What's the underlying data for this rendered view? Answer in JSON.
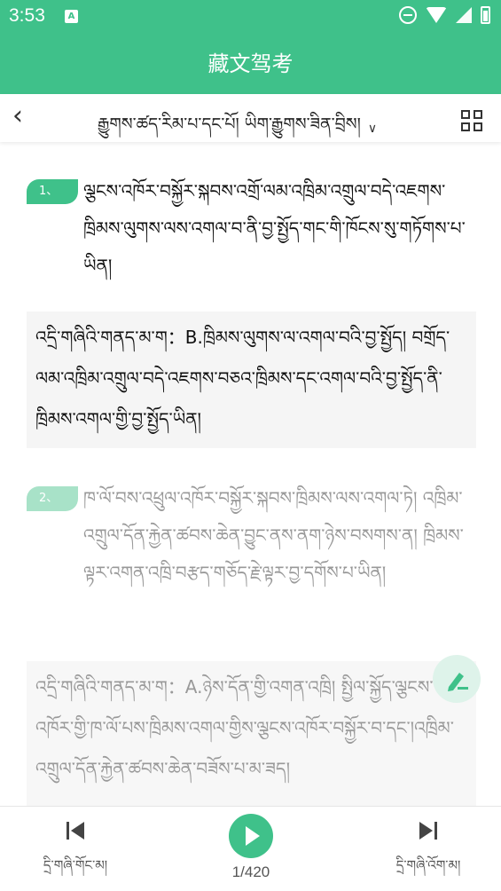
{
  "status_bar": {
    "time": "3:53",
    "sim_label": "A"
  },
  "app": {
    "title": "藏文驾考"
  },
  "nav": {
    "chapter_label": "རྒྱུགས་ཚད་རིམ་པ་དང་པོ། ཡིག་རྒྱུགས་ཟིན་བྲིས།"
  },
  "questions": [
    {
      "number": "1、",
      "text": "ལྕངས་འཁོར་བསྐྱོར་སྐབས་འགྲོ་ལམ་འཁྲིམ་འགྲུལ་བདེ་འཇགས་ཁྲིམས་ལུགས་ལས་འགལ་བ་ནི་བྱ་སྤྱོད་གང་གི་ཁོངས་སུ་གཏོགས་པ་ཡིན།",
      "answer": "འདྲི་གཞིའི་གནད་མ་ག：B.ཁྲིམས་ལུགས་ལ་འགལ་བའི་བྱ་སྤྱོད། བགྲོད་ལམ་འཁྲིམ་འགྲུལ་བདེ་འཇགས་བཅའ་ཁྲིམས་དང་འགལ་བའི་བྱ་སྤྱོད་ནི་ཁྲིམས་འགལ་གྱི་བྱ་སྤྱོད་ཡིན།"
    },
    {
      "number": "2、",
      "text": "ཁ་ལོ་བས་འཕྲུལ་འཁོར་བསྐྱོར་སྐབས་ཁྲིམས་ལས་འགལ་ཏེ། འཁྲིམ་འགྲུལ་དོན་རྐྱེན་ཚབས་ཆེན་བྱུང་ནས་ནག་ཉེས་བསགས་ན། ཁྲིམས་ལྟར་འགན་འཁྲི་བརྩད་གཅོད་རྗེ་ལྟར་བྱ་དགོས་པ་ཡིན།",
      "answer": "འདྲི་གཞིའི་གནད་མ་ག：A.ཉེས་དོན་གྱི་འགན་འཁྲི། སྤྱིལ་སྐྱོད་ལྕངས་འཁོར་གྱི་ཁ་ལོ་པས་ཁྲིམས་འགལ་གྱིས་ལྕངས་འཁོར་བསྐྱོར་བ་དང་།འཁྲིམ་འགྲུལ་དོན་རྐྱེན་ཚབས་ཆེན་བཟོས་པ་མ་ཟད།"
    }
  ],
  "bottom": {
    "prev_label": "དྲི་གཞི་གོང་མ།",
    "next_label": "དྲི་གཞི་འོག་མ།",
    "counter": "1/420"
  },
  "colors": {
    "accent": "#3fc18a",
    "accent_light": "#a8e2c8",
    "answer_bg": "#f5f5f5"
  },
  "icons": {
    "back": "chevron-left-icon",
    "dropdown": "chevron-down-icon",
    "grid": "grid-icon",
    "prev": "skip-previous-icon",
    "play": "play-icon",
    "next": "skip-next-icon",
    "edit": "pen-icon"
  }
}
